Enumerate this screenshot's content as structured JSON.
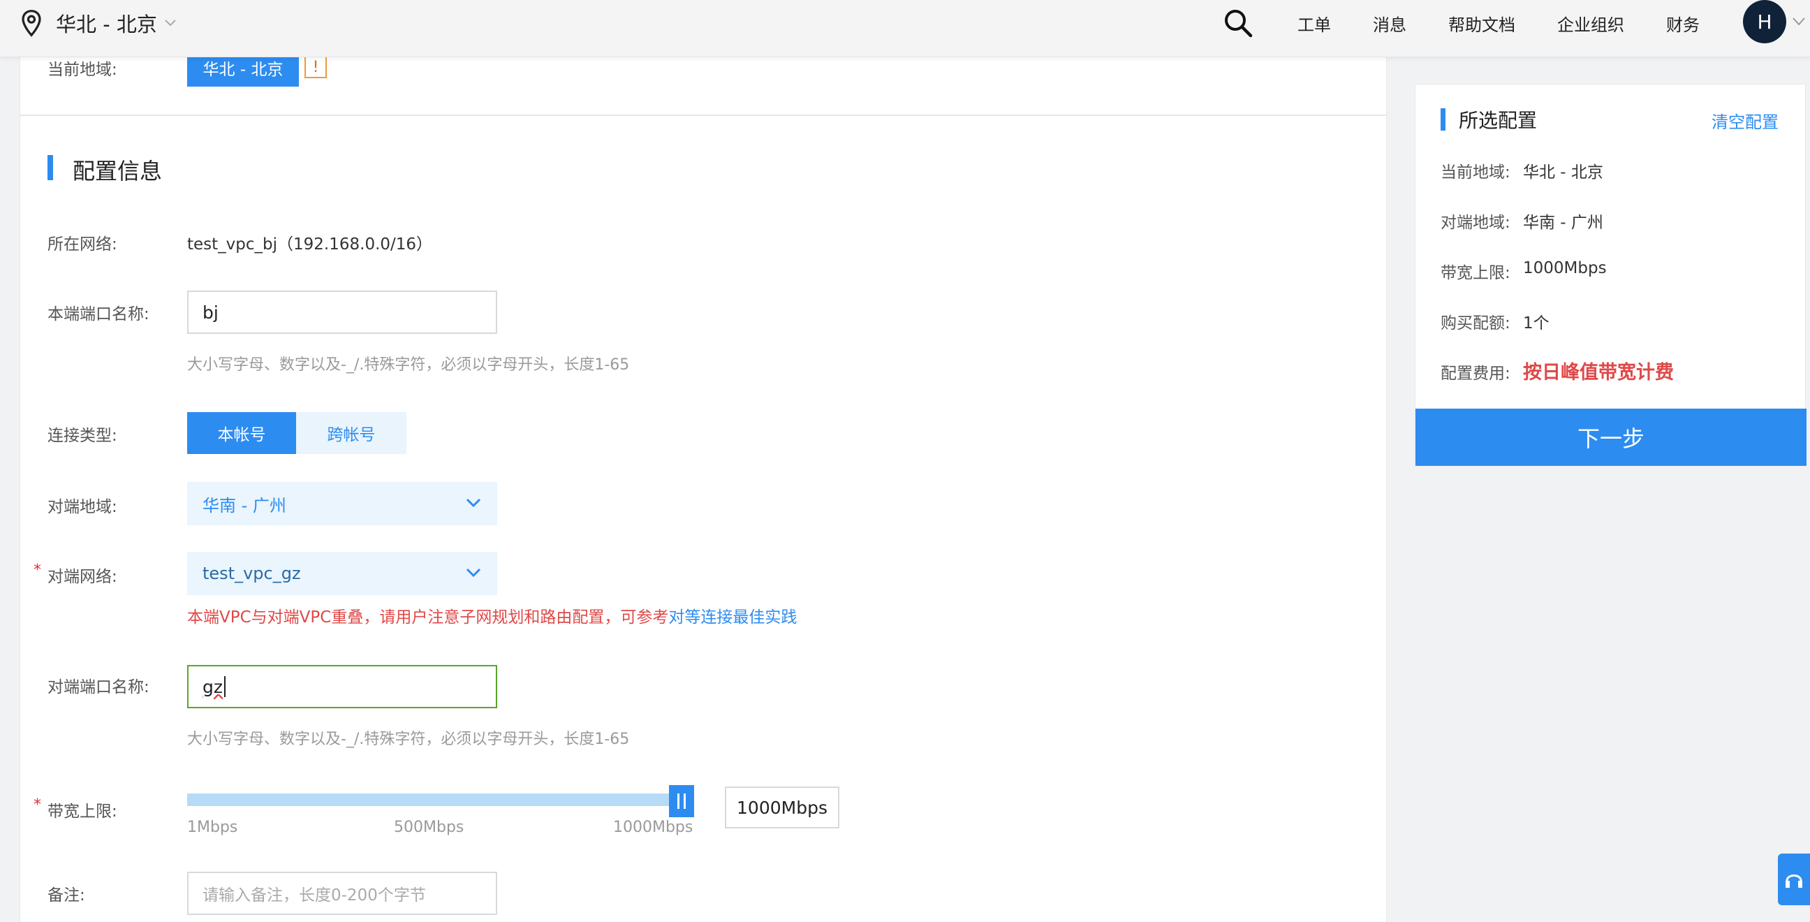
{
  "header": {
    "region": "华北 - 北京",
    "nav": [
      "工单",
      "消息",
      "帮助文档",
      "企业组织",
      "财务"
    ],
    "avatar_letter": "H"
  },
  "current_region": {
    "label": "当前地域:",
    "value": "华北 - 北京",
    "warn": "!"
  },
  "config": {
    "section_title": "配置信息",
    "network_label": "所在网络:",
    "network_value": "test_vpc_bj（192.168.0.0/16）",
    "local_port_label": "本端端口名称:",
    "local_port_value": "bj",
    "port_hint": "大小写字母、数字以及-_/.特殊字符，必须以字母开头，长度1-65",
    "conn_type_label": "连接类型:",
    "conn_type_options": [
      "本帐号",
      "跨帐号"
    ],
    "peer_region_label": "对端地域:",
    "peer_region_value": "华南 - 广州",
    "peer_network_label": "对端网络:",
    "peer_network_value": "test_vpc_gz",
    "required_mark": "*",
    "error_text": "本端VPC与对端VPC重叠，请用户注意子网规划和路由配置，可参考",
    "error_link": "对等连接最佳实践",
    "peer_port_label": "对端端口名称:",
    "peer_port_value": "gz",
    "bandwidth_label": "带宽上限:",
    "bandwidth_ticks": [
      "1Mbps",
      "500Mbps",
      "1000Mbps"
    ],
    "bandwidth_value": "1000Mbps",
    "bandwidth_fraction": 1.0,
    "remark_label": "备注:",
    "remark_placeholder": "请输入备注，长度0-200个字节"
  },
  "summary": {
    "title": "所选配置",
    "clear": "清空配置",
    "rows": [
      {
        "label": "当前地域:",
        "value": "华北 - 北京"
      },
      {
        "label": "对端地域:",
        "value": "华南 - 广州"
      },
      {
        "label": "带宽上限:",
        "value": "1000Mbps"
      },
      {
        "label": "购买配额:",
        "value": "1个"
      },
      {
        "label": "配置费用:",
        "value": "按日峰值带宽计费"
      }
    ],
    "next": "下一步"
  },
  "colors": {
    "accent": "#2d8cf0",
    "error": "#e04848",
    "focus": "#5aa52c"
  }
}
